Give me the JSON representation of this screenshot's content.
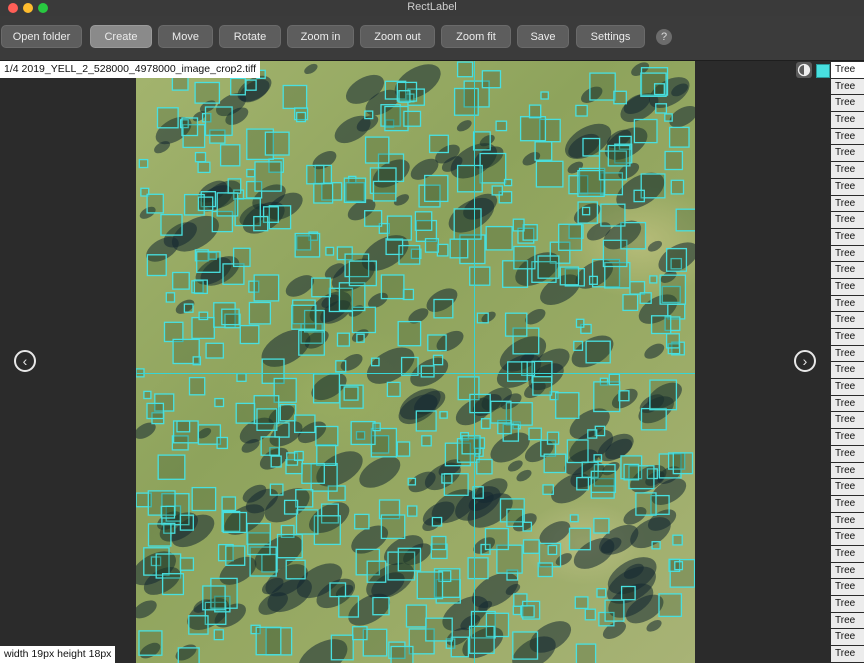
{
  "window": {
    "title": "RectLabel"
  },
  "toolbar": {
    "buttons": [
      {
        "label": "Open folder"
      },
      {
        "label": "Create"
      },
      {
        "label": "Move"
      },
      {
        "label": "Rotate"
      },
      {
        "label": "Zoom in"
      },
      {
        "label": "Zoom out"
      },
      {
        "label": "Zoom fit"
      },
      {
        "label": "Save"
      },
      {
        "label": "Settings"
      }
    ],
    "help_label": "?"
  },
  "image": {
    "file_label": "1/4 2019_YELL_2_528000_4978000_image_crop2.tiff"
  },
  "status": {
    "text": "width 19px height 18px"
  },
  "colors": {
    "box": "#48e0e0",
    "crosshair": "#36d6d6"
  },
  "icons": {
    "prev": "chevron-left-icon",
    "next": "chevron-right-icon",
    "contrast": "contrast-icon"
  },
  "labels": {
    "items": [
      "Tree",
      "Tree",
      "Tree",
      "Tree",
      "Tree",
      "Tree",
      "Tree",
      "Tree",
      "Tree",
      "Tree",
      "Tree",
      "Tree",
      "Tree",
      "Tree",
      "Tree",
      "Tree",
      "Tree",
      "Tree",
      "Tree",
      "Tree",
      "Tree",
      "Tree",
      "Tree",
      "Tree",
      "Tree",
      "Tree",
      "Tree",
      "Tree",
      "Tree",
      "Tree",
      "Tree",
      "Tree",
      "Tree",
      "Tree",
      "Tree",
      "Tree"
    ]
  }
}
